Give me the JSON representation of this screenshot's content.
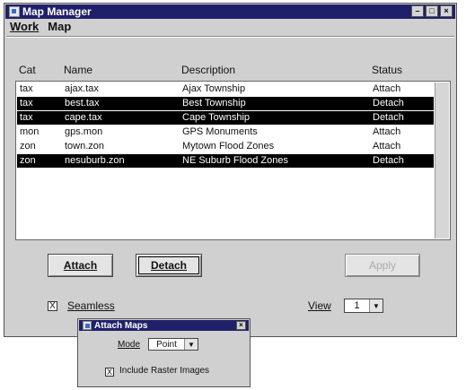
{
  "window": {
    "title": "Map Manager",
    "controls": [
      "–",
      "□",
      "×"
    ]
  },
  "menu": [
    "Work",
    "Map"
  ],
  "columns": [
    "Cat",
    "Name",
    "Description",
    "Status"
  ],
  "rows": [
    {
      "cat": "tax",
      "name": "ajax.tax",
      "desc": "Ajax Township",
      "status": "Attach",
      "selected": false
    },
    {
      "cat": "tax",
      "name": "best.tax",
      "desc": "Best Township",
      "status": "Detach",
      "selected": true
    },
    {
      "cat": "tax",
      "name": "cape.tax",
      "desc": "Cape Township",
      "status": "Detach",
      "selected": true
    },
    {
      "cat": "mon",
      "name": "gps.mon",
      "desc": "GPS Monuments",
      "status": "Attach",
      "selected": false
    },
    {
      "cat": "zon",
      "name": "town.zon",
      "desc": "Mytown Flood Zones",
      "status": "Attach",
      "selected": false
    },
    {
      "cat": "zon",
      "name": "nesuburb.zon",
      "desc": "NE Suburb Flood Zones",
      "status": "Detach",
      "selected": true
    }
  ],
  "buttons": {
    "attach": "Attach",
    "detach": "Detach",
    "apply": "Apply"
  },
  "seamless": {
    "label": "Seamless",
    "checked": true,
    "mark": "X"
  },
  "view": {
    "label": "View",
    "value": "1",
    "arrow": "▼"
  },
  "attach_maps": {
    "title": "Attach Maps",
    "close": "×",
    "mode_label": "Mode",
    "mode_value": "Point",
    "arrow": "▼",
    "include_label": "Include Raster Images",
    "include_checked": true,
    "mark": "X"
  },
  "colors": {
    "title_bar": "#20206a",
    "selection": "#000000",
    "window_bg": "#d0d0d0"
  }
}
